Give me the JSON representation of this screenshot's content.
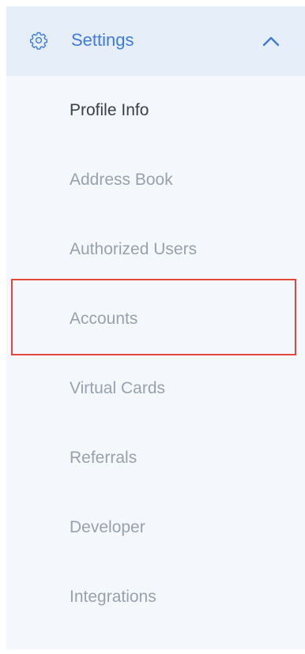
{
  "section": {
    "label": "Settings",
    "icon": "gear-icon",
    "chevron": "chevron-up-icon",
    "accent_color": "#3e7bdc"
  },
  "menu": {
    "items": [
      {
        "label": "Profile Info",
        "active": true
      },
      {
        "label": "Address Book",
        "active": false
      },
      {
        "label": "Authorized Users",
        "active": false
      },
      {
        "label": "Accounts",
        "active": false,
        "highlighted": true
      },
      {
        "label": "Virtual Cards",
        "active": false
      },
      {
        "label": "Referrals",
        "active": false
      },
      {
        "label": "Developer",
        "active": false
      },
      {
        "label": "Integrations",
        "active": false
      }
    ]
  },
  "colors": {
    "highlight_border": "#e5453f",
    "active_text": "#3a3f47",
    "inactive_text": "#98a1ad",
    "header_background": "#e6eef9",
    "panel_background": "#f4f7fc"
  }
}
